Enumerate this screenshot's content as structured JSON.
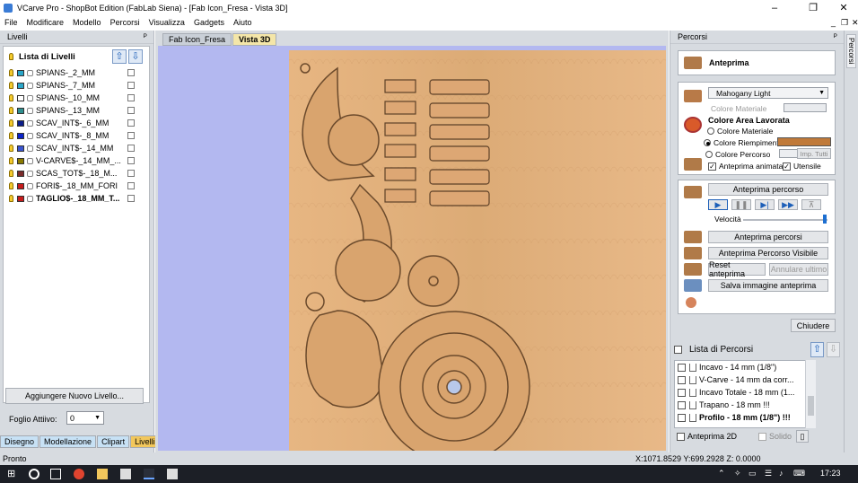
{
  "window": {
    "title": "VCarve Pro - ShopBot Edition (FabLab Siena) - [Fab Icon_Fresa - Vista 3D]",
    "controls": [
      "–",
      "❐",
      "✕"
    ]
  },
  "menu": [
    "File",
    "Modificare",
    "Modello",
    "Percorsi",
    "Visualizza",
    "Gadgets",
    "Aiuto"
  ],
  "left_panel": {
    "title": "Livelli",
    "pin": "ᴾ",
    "list_title": "Lista di Livelli",
    "layers": [
      {
        "name": "SPIANS-_2_MM",
        "color": "#2aa6c9",
        "bold": false
      },
      {
        "name": "SPIANS-_7_MM",
        "color": "#2aa6c9",
        "bold": false
      },
      {
        "name": "SPIANS-_10_MM",
        "color": "#ffffff",
        "bold": false
      },
      {
        "name": "SPIANS-_13_MM",
        "color": "#2f8f8f",
        "bold": false
      },
      {
        "name": "SCAV_INT$-_6_MM",
        "color": "#0a1d8a",
        "bold": false
      },
      {
        "name": "SCAV_INT$-_8_MM",
        "color": "#0a22c9",
        "bold": false
      },
      {
        "name": "SCAV_INT$-_14_MM",
        "color": "#3a55d1",
        "bold": false
      },
      {
        "name": "V-CARVE$-_14_MM_...",
        "color": "#8a7a00",
        "bold": false
      },
      {
        "name": "SCAS_TOT$-_18_M...",
        "color": "#7a2a2a",
        "bold": false
      },
      {
        "name": "FORI$-_18_MM_FORI",
        "color": "#c61b1b",
        "bold": false
      },
      {
        "name": "TAGLIO$-_18_MM_T...",
        "color": "#c61b1b",
        "bold": true
      }
    ],
    "add_layer_button": "Aggiungere Nuovo Livello...",
    "active_sheet_label": "Foglio Attiivo:",
    "active_sheet_value": "0",
    "tabs": [
      "Disegno",
      "Modellazione",
      "Clipart",
      "Livelli"
    ],
    "active_tab": "Livelli"
  },
  "center": {
    "tabs": [
      "Fab Icon_Fresa",
      "Vista 3D"
    ],
    "active_tab": "Vista 3D"
  },
  "right_panel": {
    "title": "Percorsi",
    "pin": "ᴾ",
    "preview_header": "Anteprima",
    "material_select": "Mahogany Light",
    "material_color_label": "Colore Materiale",
    "area_title": "Colore Area Lavorata",
    "radio_options": [
      "Colore Materiale",
      "Colore Riempimento",
      "Colore Percorso"
    ],
    "selected_radio": "Colore Riempimento",
    "imp_tutti": "Imp. Tutti",
    "animated_label": "Anteprima animata",
    "tools_label": "Utensile",
    "preview_toolpath_button": "Anteprima percorso",
    "play_controls": [
      "▶",
      "❚❚",
      "▶|",
      "▶▶",
      "⊼"
    ],
    "speed_label": "Velocità",
    "buttons": [
      "Anteprima percorsi",
      "Anteprima Percorso Visibile",
      "Reset anteprima",
      "Annulare ultimo",
      "Salva immagine anteprima"
    ],
    "close_button": "Chiudere",
    "toolpath_list_title": "Lista di Percorsi",
    "toolpaths": [
      {
        "name": "Incavo - 14 mm (1/8\")",
        "bold": false
      },
      {
        "name": "V-Carve - 14 mm da corr...",
        "bold": false
      },
      {
        "name": "Incavo Totale - 18 mm (1...",
        "bold": false
      },
      {
        "name": "Trapano - 18 mm !!!",
        "bold": false
      },
      {
        "name": "Profilo - 18 mm (1/8\") !!!",
        "bold": true
      }
    ],
    "preview_2d_label": "Anteprima 2D",
    "solid_label": "Solido"
  },
  "side_strip_label": "Percorsi",
  "status": {
    "left": "Pronto",
    "coords": "X:1071.8529 Y:699.2928 Z: 0.0000"
  },
  "taskbar": {
    "time": "17:23"
  },
  "colors": {
    "wood": "#e3b07a",
    "viewport_bg": "#b3b8f0",
    "accent_tab": "#f2c75c"
  }
}
